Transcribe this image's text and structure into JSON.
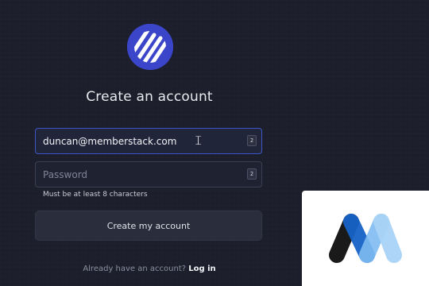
{
  "page": {
    "title": "Create an account"
  },
  "form": {
    "email_value": "duncan@memberstack.com",
    "password_placeholder": "Password",
    "password_hint": "Must be at least 8 characters",
    "submit_label": "Create my account",
    "password_manager_badge": "2"
  },
  "footer": {
    "prompt": "Already have an account?",
    "login_label": "Log in"
  },
  "colors": {
    "background": "#1c1f2b",
    "logo": "#3b45c9",
    "focus_border": "#3c56c6",
    "brand_dark_blue": "#1763c7",
    "brand_light_blue": "#7fbcf2",
    "brand_black": "#161616"
  },
  "icons": [
    "app-logo-icon",
    "password-manager-icon",
    "text-cursor-icon",
    "memberstack-logo-icon"
  ]
}
